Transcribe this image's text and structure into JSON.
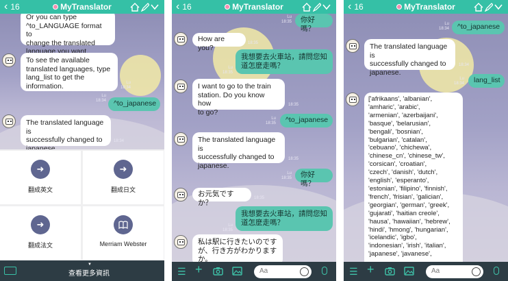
{
  "header": {
    "back_count": "16",
    "title": "MyTranslator",
    "home_icon": "home-icon",
    "note_icon": "note-icon",
    "menu_icon": "chevron-down-icon",
    "color": "#35c0a6"
  },
  "screen1": {
    "messages": [
      {
        "text": "Or you can type\n^to_LANGUAGE format to\nchange the translated\nlanguage you want."
      },
      {
        "text": "To see the available\ntranslated languages, type\nlang_list to get the\ninformation.",
        "time": "Lu\n18:34"
      },
      {
        "text": "^to_japanese",
        "time": "Lu\n18:34"
      },
      {
        "text": "The translated language is\nsuccessfully changed to\njapanese.",
        "time": "18:34"
      }
    ],
    "rich_menu": [
      {
        "label": "翻成英文",
        "icon": "arrow-right-icon"
      },
      {
        "label": "翻成日文",
        "icon": "arrow-right-icon"
      },
      {
        "label": "翻成法文",
        "icon": "arrow-right-icon"
      },
      {
        "label": "Merriam Webster",
        "icon": "book-icon"
      }
    ],
    "more_label": "查看更多資訊"
  },
  "screen2": {
    "messages": [
      {
        "text": "你好嗎？",
        "time": "Lu\n18:35"
      },
      {
        "text": "How are you?",
        "time": "18:35"
      },
      {
        "text": "我想要去火車站，請問您知\n道怎麼走嗎？",
        "time": "Lu\n18:35"
      },
      {
        "text": "I want to go to the train\nstation. Do you know how\nto go?",
        "time": "18:35"
      },
      {
        "text": "^to_japanese",
        "time": "Lu\n18:35"
      },
      {
        "text": "The translated language is\nsuccessfully changed to\njapanese.",
        "time": "18:35"
      },
      {
        "text": "你好嗎？",
        "time": "Lu\n18:35"
      },
      {
        "text": "お元気ですか？",
        "time": "18:35"
      },
      {
        "text": "我想要去火車站，請問您知\n道怎麼走嗎？",
        "time": "Lu\n18:35"
      },
      {
        "text": "私は駅に行きたいのです\nが、行き方がわかります\nか。"
      }
    ]
  },
  "screen3": {
    "messages": [
      {
        "text": "^to_japanese",
        "time": "Lu\n18:34"
      },
      {
        "text": "The translated language is\nsuccessfully changed to\njapanese.",
        "time": "18:34"
      },
      {
        "text": "lang_list",
        "time": "Lu\n18:34"
      },
      {
        "text": "['afrikaans', 'albanian',\n'amharic', 'arabic',\n'armenian', 'azerbaijani',\n'basque', 'belarusian',\n'bengali', 'bosnian',\n'bulgarian', 'catalan',\n'cebuano', 'chichewa',\n'chinese_cn', 'chinese_tw',\n'corsican', 'croatian',\n'czech', 'danish', 'dutch',\n'english', 'esperanto',\n'estonian', 'filipino', 'finnish',\n'french', 'frisian', 'galician',\n'georgian', 'german', 'greek',\n'gujarati', 'haitian creole',\n'hausa', 'hawaiian', 'hebrew',\n'hindi', 'hmong', 'hungarian',\n'icelandic', 'igbo',\n'indonesian', 'irish', 'italian',\n'japanese', 'javanese',"
      }
    ]
  },
  "input_bar": {
    "placeholder": "Aa",
    "icons": [
      "menu-icon",
      "plus-icon",
      "camera-icon",
      "image-icon",
      "emoji-icon",
      "mic-icon"
    ]
  }
}
